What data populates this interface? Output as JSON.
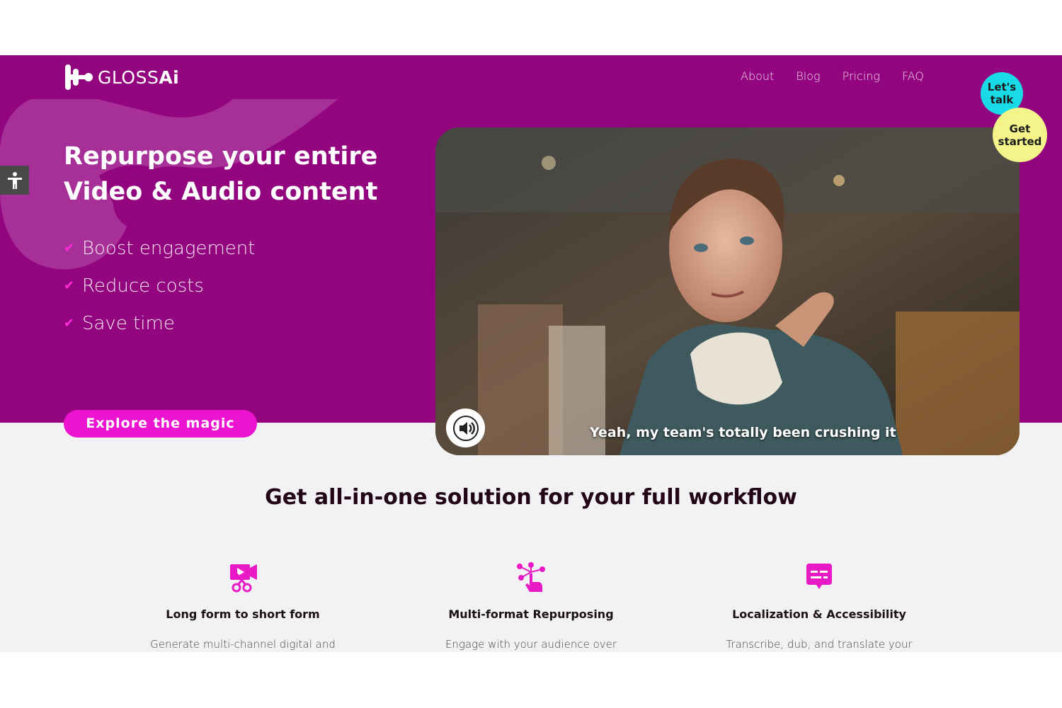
{
  "brand": {
    "logo_text_light": "GLOSS",
    "logo_text_bold": "Ai",
    "primary_color": "#93057f",
    "accent_color": "#ec14d0"
  },
  "nav": {
    "items": [
      {
        "label": "About"
      },
      {
        "label": "Blog"
      },
      {
        "label": "Pricing"
      },
      {
        "label": "FAQ"
      }
    ]
  },
  "floating": {
    "lets_talk": "Let's talk",
    "get_started": "Get started"
  },
  "hero": {
    "title_line1": "Repurpose your entire",
    "title_line2": "Video & Audio content",
    "bullets": [
      {
        "label": "Boost engagement"
      },
      {
        "label": "Reduce costs"
      },
      {
        "label": "Save time"
      }
    ],
    "cta_label": "Explore the magic"
  },
  "video": {
    "caption": "Yeah, my team's totally been crushing it",
    "mute_icon": "speaker-icon"
  },
  "accessibility": {
    "icon": "accessibility-icon"
  },
  "solutions": {
    "title": "Get all-in-one solution for your full workflow",
    "features": [
      {
        "icon": "video-scissors-icon",
        "title": "Long form to short form",
        "desc": "Generate multi-channel digital and"
      },
      {
        "icon": "hand-network-icon",
        "title": "Multi-format Repurposing",
        "desc": "Engage with your audience over"
      },
      {
        "icon": "subtitles-chat-icon",
        "title": "Localization & Accessibility",
        "desc": "Transcribe, dub, and translate your"
      }
    ]
  }
}
